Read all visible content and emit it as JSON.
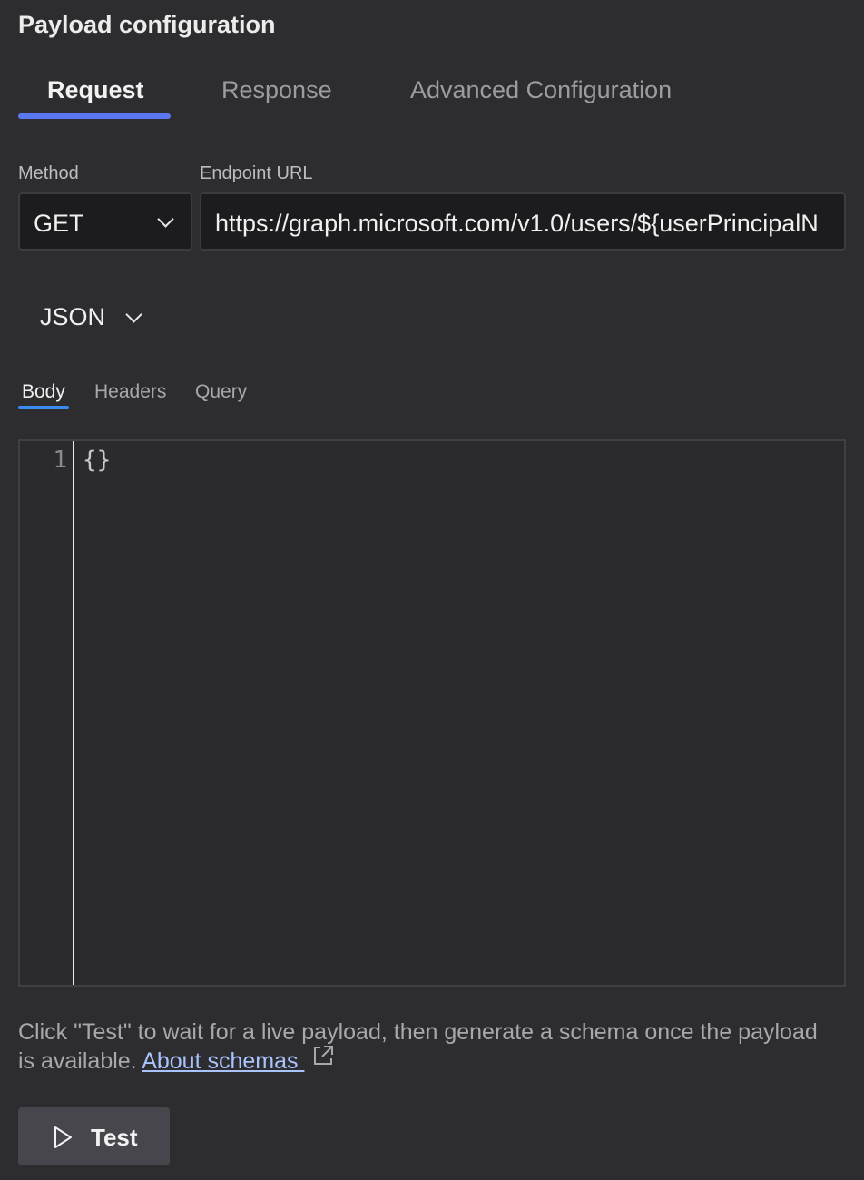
{
  "panel": {
    "title": "Payload configuration"
  },
  "main_tabs": [
    {
      "label": "Request",
      "active": true
    },
    {
      "label": "Response",
      "active": false
    },
    {
      "label": "Advanced Configuration",
      "active": false
    }
  ],
  "request": {
    "method_label": "Method",
    "method_value": "GET",
    "url_label": "Endpoint URL",
    "url_value": "https://graph.microsoft.com/v1.0/users/${userPrincipalN",
    "format_value": "JSON"
  },
  "sub_tabs": [
    {
      "label": "Body",
      "active": true
    },
    {
      "label": "Headers",
      "active": false
    },
    {
      "label": "Query",
      "active": false
    }
  ],
  "editor": {
    "lines": [
      {
        "number": "1",
        "code": "{}"
      }
    ]
  },
  "help": {
    "text": "Click \"Test\" to wait for a live payload, then generate a schema once the payload is available. ",
    "link_label": "About schemas ",
    "link_icon": "external-link-icon"
  },
  "test_button": {
    "label": "Test",
    "icon": "play-icon"
  },
  "colors": {
    "background": "#2d2d30",
    "main_tab_accent": "#5b78f0",
    "sub_tab_accent": "#3a8cf2",
    "link": "#a9c3ff"
  }
}
